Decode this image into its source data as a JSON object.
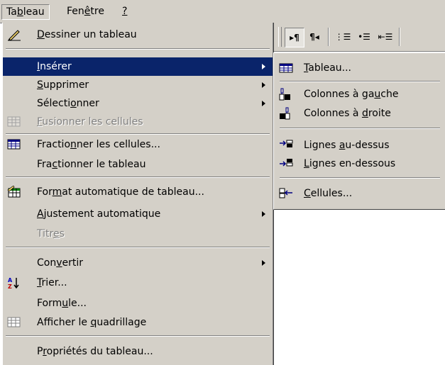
{
  "menubar": {
    "items": [
      {
        "pre": "Ta",
        "key": "b",
        "post": "leau"
      },
      {
        "pre": "Fen",
        "key": "ê",
        "post": "tre"
      },
      {
        "pre": "",
        "key": "?",
        "post": ""
      }
    ]
  },
  "menu": {
    "items": [
      {
        "pre": "",
        "key": "D",
        "post": "essiner un tableau",
        "icon": "pencil-icon"
      },
      {
        "pre": "",
        "key": "I",
        "post": "nsérer",
        "submenu": true,
        "highlighted": true
      },
      {
        "pre": "",
        "key": "S",
        "post": "upprimer",
        "submenu": true
      },
      {
        "pre": "Sélecti",
        "key": "o",
        "post": "nner",
        "submenu": true
      },
      {
        "pre": "",
        "key": "F",
        "post": "usionner les cellules",
        "disabled": true,
        "icon": "merge-cells-icon"
      },
      {
        "pre": "Fractio",
        "key": "n",
        "post": "ner les cellules...",
        "icon": "split-cells-icon"
      },
      {
        "pre": "Fra",
        "key": "c",
        "post": "tionner le tableau"
      },
      {
        "pre": "For",
        "key": "m",
        "post": "at automatique de tableau...",
        "icon": "table-autoformat-icon"
      },
      {
        "pre": "",
        "key": "A",
        "post": "justement automatique",
        "submenu": true
      },
      {
        "pre": "Titr",
        "key": "e",
        "post": "s",
        "disabled": true
      },
      {
        "pre": "Con",
        "key": "v",
        "post": "ertir",
        "submenu": true
      },
      {
        "pre": "",
        "key": "T",
        "post": "rier...",
        "icon": "sort-az-icon"
      },
      {
        "pre": "Form",
        "key": "u",
        "post": "le..."
      },
      {
        "pre": "Afficher le ",
        "key": "q",
        "post": "uadrillage",
        "icon": "gridlines-icon"
      },
      {
        "pre": "P",
        "key": "r",
        "post": "opriétés du tableau..."
      }
    ]
  },
  "submenu": {
    "items": [
      {
        "pre": "",
        "key": "T",
        "post": "ableau...",
        "icon": "insert-table-icon"
      },
      {
        "pre": "Colonnes à ga",
        "key": "u",
        "post": "che",
        "icon": "insert-columns-left-icon"
      },
      {
        "pre": "Colonnes à ",
        "key": "d",
        "post": "roite",
        "icon": "insert-columns-right-icon"
      },
      {
        "pre": "Lignes ",
        "key": "a",
        "post": "u-dessus",
        "icon": "insert-rows-above-icon"
      },
      {
        "pre": "",
        "key": "L",
        "post": "ignes en-dessous",
        "icon": "insert-rows-below-icon"
      },
      {
        "pre": "",
        "key": "C",
        "post": "ellules...",
        "icon": "insert-cells-icon"
      }
    ]
  },
  "toolbar": {
    "buttons": [
      {
        "glyph": "▸¶",
        "icon": "left-to-right-icon",
        "pressed": true
      },
      {
        "glyph": "¶◂",
        "icon": "right-to-left-icon",
        "pressed": false
      },
      {
        "glyph": "⋮☰",
        "icon": "numbering-icon",
        "pressed": false
      },
      {
        "glyph": "•☰",
        "icon": "bullets-icon",
        "pressed": false
      },
      {
        "glyph": "⇤☰",
        "icon": "decrease-indent-icon",
        "pressed": false
      }
    ]
  },
  "colors": {
    "menu_bg": "#d4d0c8",
    "highlight": "#0a246a",
    "disabled": "#808080"
  }
}
